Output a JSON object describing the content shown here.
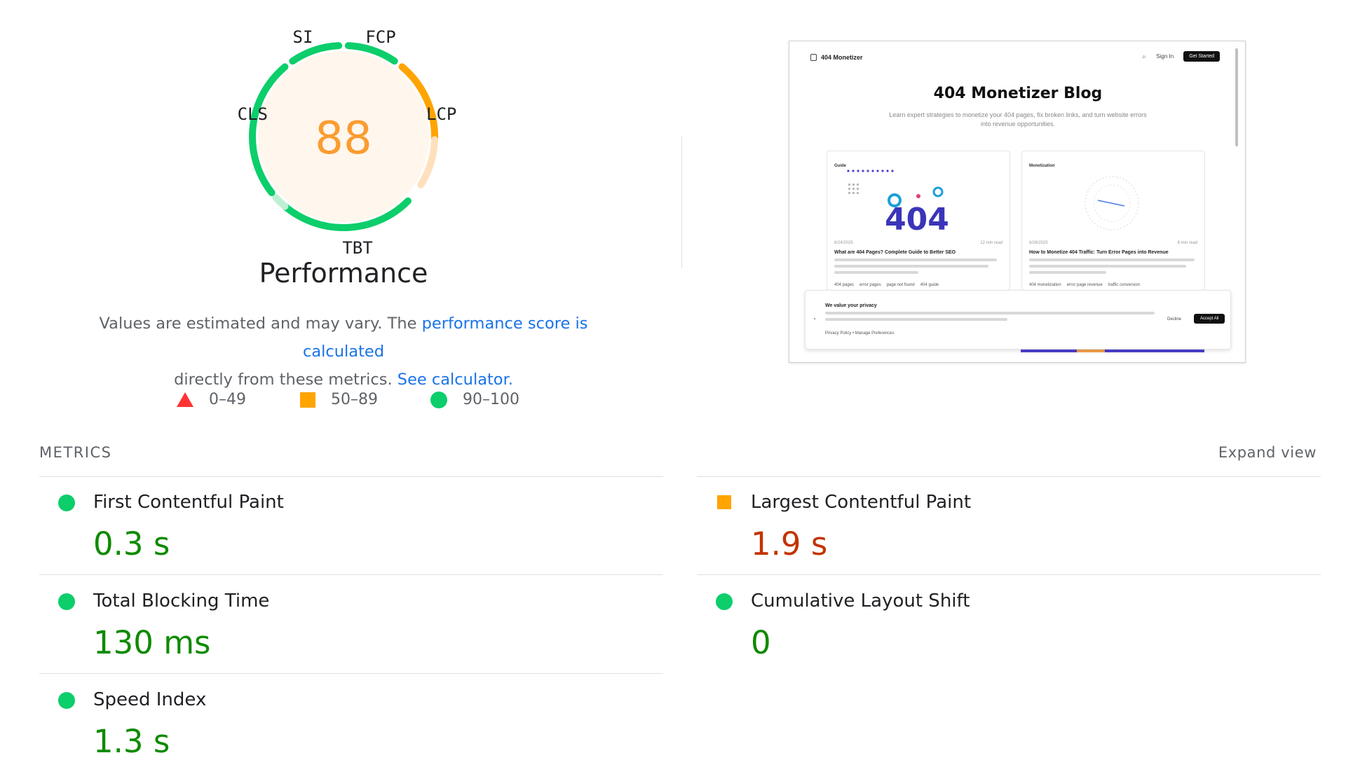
{
  "gauge": {
    "score": "88",
    "labels": {
      "si": "SI",
      "fcp": "FCP",
      "lcp": "LCP",
      "tbt": "TBT",
      "cls": "CLS"
    },
    "colors": {
      "pass": "#0cce6b",
      "average": "#ffa400",
      "score_text": "#fb9c30",
      "fill": "#fff6ed"
    }
  },
  "category_title": "Performance",
  "description": {
    "part1": "Values are estimated and may vary. The ",
    "link1": "performance score is calculated",
    "part2": "directly from these metrics. ",
    "link2": "See calculator."
  },
  "legend": [
    {
      "icon": "triangle-icon",
      "range": "0–49",
      "color": "#ff3333"
    },
    {
      "icon": "square-icon",
      "range": "50–89",
      "color": "#ffa400"
    },
    {
      "icon": "circle-icon",
      "range": "90–100",
      "color": "#0cce6b"
    }
  ],
  "screenshot": {
    "brand": "404 Monetizer",
    "sign_in": "Sign In",
    "get_started": "Get Started",
    "hero_title": "404 Monetizer Blog",
    "hero_subtitle": "Learn expert strategies to monetize your 404 pages, fix broken links, and turn website errors into revenue opportunities.",
    "cards": [
      {
        "tag": "Guide",
        "date": "6/24/2025",
        "read_time": "12 min read",
        "title": "What are 404 Pages? Complete Guide to Better SEO",
        "chips": [
          "404 pages",
          "error pages",
          "page not found",
          "404 guide"
        ]
      },
      {
        "tag": "Monetization",
        "date": "6/26/2025",
        "read_time": "8 min read",
        "title": "How to Monetize 404 Traffic: Turn Error Pages into Revenue",
        "chips": [
          "404 monetization",
          "error page revenue",
          "traffic conversion"
        ]
      }
    ],
    "cookie": {
      "title": "We value your privacy",
      "links": "Privacy Policy  •  Manage Preferences",
      "decline": "Decline",
      "accept": "Accept All"
    },
    "hero_graphic_text": "404"
  },
  "metrics": {
    "header": "METRICS",
    "expand": "Expand view",
    "items": [
      {
        "id": "fcp",
        "label": "First Contentful Paint",
        "value": "0.3 s",
        "rating": "pass"
      },
      {
        "id": "lcp",
        "label": "Largest Contentful Paint",
        "value": "1.9 s",
        "rating": "average"
      },
      {
        "id": "tbt",
        "label": "Total Blocking Time",
        "value": "130 ms",
        "rating": "pass"
      },
      {
        "id": "cls",
        "label": "Cumulative Layout Shift",
        "value": "0",
        "rating": "pass"
      },
      {
        "id": "si",
        "label": "Speed Index",
        "value": "1.3 s",
        "rating": "pass"
      }
    ]
  }
}
